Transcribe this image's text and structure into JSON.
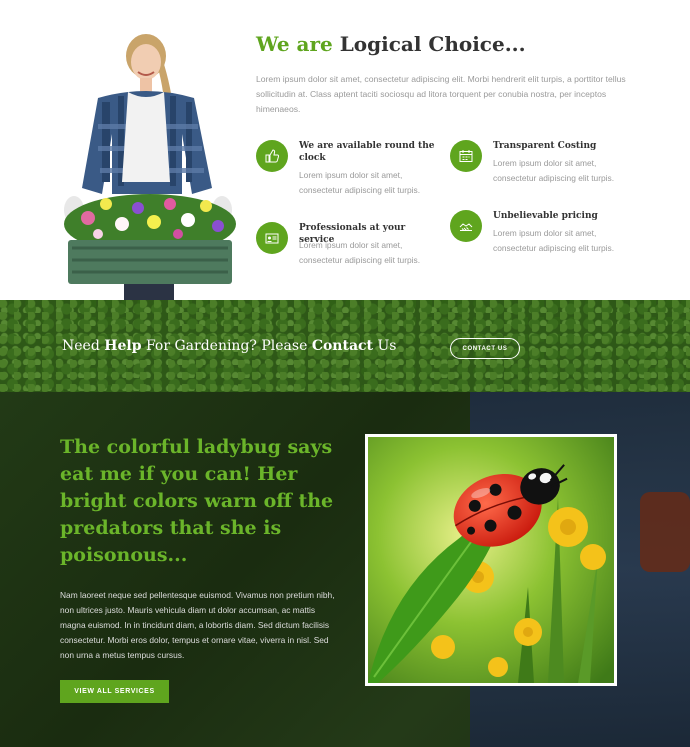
{
  "logical": {
    "title_accent": "We are",
    "title_main": "Logical Choice...",
    "intro": "Lorem ipsum dolor sit amet, consectetur adipiscing elit. Morbi hendrerit elit turpis, a porttitor tellus sollicitudin at. Class aptent taciti sociosqu ad litora torquent per conubia nostra, per inceptos himenaeos.",
    "features": [
      {
        "title": "We are available round the clock",
        "desc": "Lorem ipsum dolor sit amet, consectetur adipiscing elit turpis.",
        "icon": "thumbs-up-icon"
      },
      {
        "title": "Transparent Costing",
        "desc": "Lorem ipsum dolor sit amet, consectetur adipiscing elit turpis.",
        "icon": "calendar-icon"
      },
      {
        "title": "Professionals at your service",
        "desc": "Lorem ipsum dolor sit amet, consectetur adipiscing elit turpis.",
        "icon": "id-card-icon"
      },
      {
        "title": "Unbelievable pricing",
        "desc": "Lorem ipsum dolor sit amet, consectetur adipiscing elit turpis.",
        "icon": "handshake-icon"
      }
    ]
  },
  "banner": {
    "text_1": "Need",
    "text_2": "Help",
    "text_3": "For Gardening? Please",
    "text_4": "Contact",
    "text_5": "Us",
    "button": "CONTACT US"
  },
  "ladybug": {
    "heading": "The colorful ladybug says eat me if you can! Her bright colors warn off the predators that she is poisonous...",
    "body": "Nam laoreet neque sed pellentesque euismod. Vivamus non pretium nibh, non ultrices justo. Mauris vehicula diam ut dolor accumsan, ac mattis magna euismod. In in tincidunt diam, a lobortis diam. Sed dictum facilisis consectetur. Morbi eros dolor, tempus et ornare vitae, viverra in nisl. Sed non urna a metus tempus cursus.",
    "button": "VIEW ALL SERVICES"
  },
  "colors": {
    "accent": "#5fa51e",
    "heading_green": "#6bb52a",
    "text_gray": "#9a9a9a"
  }
}
